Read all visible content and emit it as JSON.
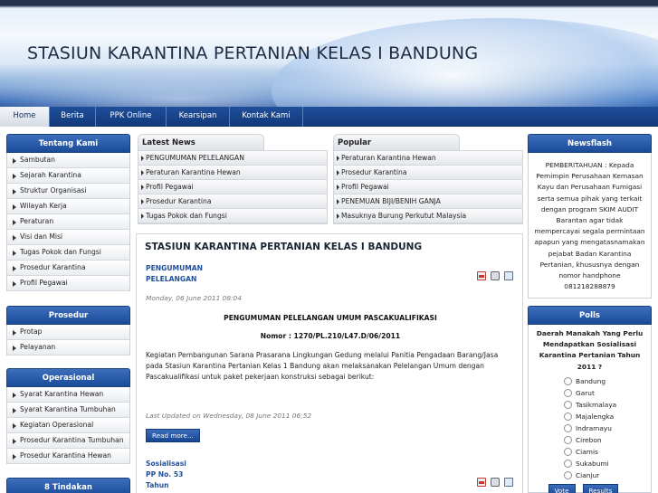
{
  "header": {
    "title": "STASIUN KARANTINA PERTANIAN KELAS I BANDUNG"
  },
  "nav": {
    "tabs": [
      "Home",
      "Berita",
      "PPK Online",
      "Kearsipan",
      "Kontak Kami"
    ],
    "active": "Home"
  },
  "left": {
    "tentang": {
      "title": "Tentang Kami",
      "items": [
        "Sambutan",
        "Sejarah Karantina",
        "Struktur Organisasi",
        "Wilayah Kerja",
        "Peraturan",
        "Visi dan Misi",
        "Tugas Pokok dan Fungsi",
        "Prosedur Karantina",
        "Profil Pegawai"
      ]
    },
    "prosedur": {
      "title": "Prosedur",
      "items": [
        "Protap",
        "Pelayanan"
      ]
    },
    "operasional": {
      "title": "Operasional",
      "items": [
        "Syarat Karantina Hewan",
        "Syarat Karantina Tumbuhan",
        "Kegiatan Operasional",
        "Prosedur Karantina Tumbuhan",
        "Prosedur Karantina Hewan"
      ]
    },
    "tindakan": {
      "title": "8 Tindakan"
    }
  },
  "latest": {
    "title": "Latest News",
    "items": [
      "PENGUMUMAN PELELANGAN",
      "Peraturan Karantina Hewan",
      "Profil Pegawai",
      "Prosedur Karantina",
      "Tugas Pokok dan Fungsi"
    ]
  },
  "popular": {
    "title": "Popular",
    "items": [
      "Peraturan Karantina Hewan",
      "Prosedur Karantina",
      "Profil Pegawai",
      "PENEMUAN BIJI/BENIH GANJA",
      "Masuknya Burung Perkutut Malaysia"
    ]
  },
  "main": {
    "title": "STASIUN KARANTINA PERTANIAN KELAS I BANDUNG",
    "article1": {
      "title_line1": "PENGUMUMAN",
      "title_line2": "PELELANGAN",
      "date": "Monday, 06 June 2011 08:04",
      "heading": "PENGUMUMAN PELELANGAN UMUM PASCAKUALIFIKASI",
      "nomor": "Nomor : 1270/PL.210/L47.D/06/2011",
      "body": "Kegiatan Pembangunan Sarana Prasarana Lingkungan Gedung melalui Panitia Pengadaan Barang/Jasa pada Stasiun Karantina Pertanian Kelas 1 Bandung akan melaksanakan Pelelangan Umum dengan Pascakualifikasi untuk paket pekerjaan konstruksi sebagai berikut:",
      "updated": "Last Updated on Wednesday, 08 June 2011 06:52",
      "readmore": "Read more..."
    },
    "article2": {
      "line1": "Sosialisasi",
      "line2": "PP No. 53",
      "line3": "Tahun"
    }
  },
  "right": {
    "newsflash": {
      "title": "Newsflash",
      "text": "PEMBERITAHUAN : Kepada Pemimpin Perusahaan Kemasan Kayu dan Perusahaan Fumigasi serta semua pihak yang terkait dengan program SKIM AUDIT Barantan agar tidak mempercayai segala permintaan apapun yang mengatasnamakan pejabat Badan Karantina Pertanian, khususnya dengan nomor handphone 081218288879"
    },
    "polls": {
      "title": "Polls",
      "question": "Daerah Manakah Yang Perlu Mendapatkan Sosialisasi Karantina Pertanian Tahun 2011 ?",
      "options": [
        "Bandung",
        "Garut",
        "Tasikmalaya",
        "Majalengka",
        "Indramayu",
        "Cirebon",
        "Ciamis",
        "Sukabumi",
        "Cianjur"
      ],
      "vote_label": "Vote",
      "results_label": "Results"
    }
  }
}
